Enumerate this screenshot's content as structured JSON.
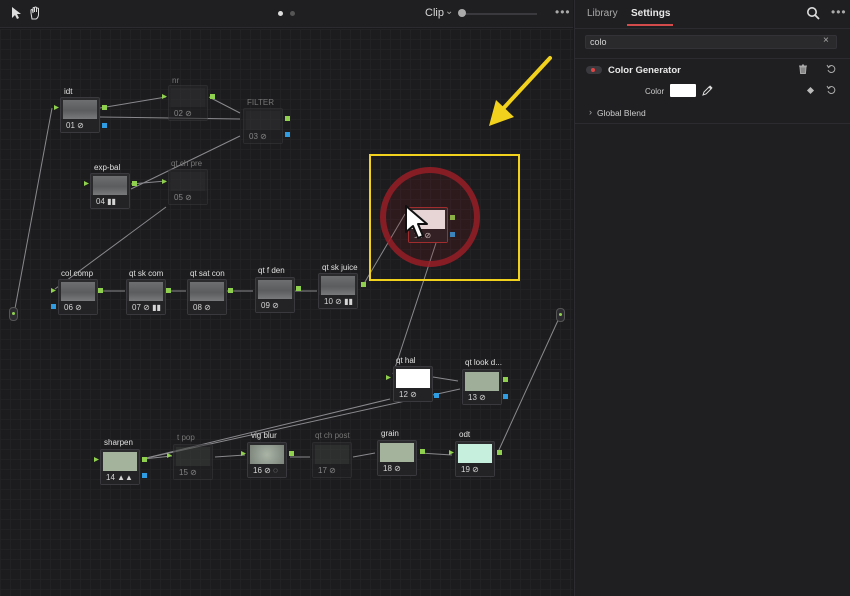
{
  "toolbar": {
    "clip_label": "Clip",
    "chevron": "⌄",
    "more": "•••",
    "icons": [
      "pointer-icon",
      "hand-icon"
    ]
  },
  "nodes": [
    {
      "label": "idt",
      "num": "01",
      "badge": "⊘",
      "thumb": "image"
    },
    {
      "label": "nr",
      "num": "02",
      "badge": "⊘",
      "thumb": "dark"
    },
    {
      "label": "FILTER",
      "num": "03",
      "badge": "⊘",
      "thumb": "dark"
    },
    {
      "label": "exp-bal",
      "num": "04",
      "badge": "▮▮",
      "thumb": "image"
    },
    {
      "label": "qt ch pre",
      "num": "05",
      "badge": "⊘",
      "thumb": "dark"
    },
    {
      "label": "col comp",
      "num": "06",
      "badge": "⊘",
      "thumb": "image"
    },
    {
      "label": "qt sk com",
      "num": "07",
      "badge": "⊘ ▮▮",
      "thumb": "image"
    },
    {
      "label": "qt sat con",
      "num": "08",
      "badge": "⊘",
      "thumb": "image"
    },
    {
      "label": "qt f den",
      "num": "09",
      "badge": "⊘",
      "thumb": "image"
    },
    {
      "label": "qt sk juice",
      "num": "10",
      "badge": "⊘ ▮▮",
      "thumb": "image"
    },
    {
      "label": "",
      "num": "11",
      "badge": "⊘",
      "thumb": "white"
    },
    {
      "label": "qt hal",
      "num": "12",
      "badge": "⊘",
      "thumb": "white"
    },
    {
      "label": "qt look d...",
      "num": "13",
      "badge": "⊘",
      "thumb": "sage"
    },
    {
      "label": "sharpen",
      "num": "14",
      "badge": "▲▲",
      "thumb": "sage2"
    },
    {
      "label": "t pop",
      "num": "15",
      "badge": "⊘",
      "thumb": "dgray"
    },
    {
      "label": "vig blur",
      "num": "16",
      "badge": "⊘ ◌",
      "thumb": "blur"
    },
    {
      "label": "qt ch post",
      "num": "17",
      "badge": "⊘",
      "thumb": "dgray"
    },
    {
      "label": "grain",
      "num": "18",
      "badge": "⊘",
      "thumb": "sage2"
    },
    {
      "label": "odt",
      "num": "19",
      "badge": "⊘",
      "thumb": "mint"
    }
  ],
  "panel": {
    "tab_library": "Library",
    "tab_settings": "Settings",
    "more": "•••",
    "search_value": "colo",
    "search_clear": "×",
    "effect_title": "Color Generator",
    "color_label": "Color",
    "color_value": "#ffffff",
    "global_blend_chevron": "›",
    "global_blend": "Global Blend"
  },
  "colors": {
    "highlight": "#f2d21d",
    "cursor_ring": "#961e28",
    "tab_accent": "#d34b4b",
    "pin_green": "#8fd14f",
    "pin_blue": "#2f9be0"
  }
}
